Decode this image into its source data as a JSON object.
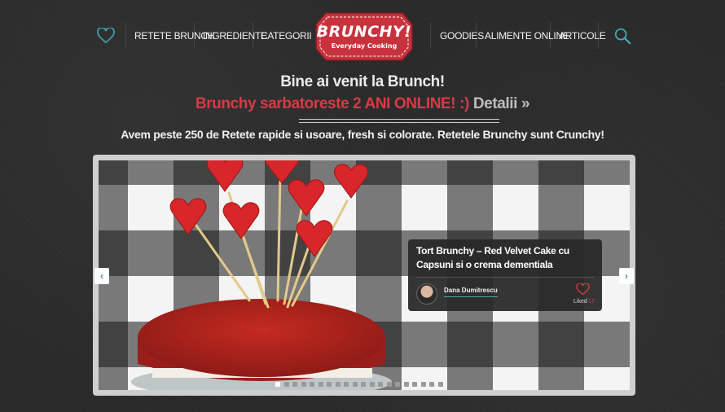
{
  "nav": {
    "left": [
      "RETETE BRUNCH",
      "INGREDIENTE",
      "CATEGORII"
    ],
    "right": [
      "GOODIES",
      "ALIMENTE ONLINE",
      "ARTICOLE"
    ]
  },
  "logo": {
    "title": "BRUNCHY!",
    "subtitle": "Everyday Cooking"
  },
  "hero": {
    "welcome": "Bine ai venit la Brunch!",
    "promo": "Brunchy sarbatoreste 2 ANI ONLINE! :)",
    "details": "Detalii »",
    "tagline": "Avem peste 250 de Retete rapide si usoare, fresh si colorate. Retetele Brunchy sunt Crunchy!"
  },
  "slider": {
    "recipe_title": "Tort Brunchy – Red Velvet Cake cu Capsuni si o crema dementiala",
    "author": "Dana Dumitrescu",
    "liked_label": "Liked",
    "liked_count": "17",
    "prev_arrow": "‹",
    "next_arrow": "›",
    "slide_count": 20,
    "active_slide": 1
  },
  "colors": {
    "accent_red": "#d83a44",
    "accent_teal": "#3fa9b4",
    "background": "#2a2a2a"
  },
  "icons": [
    "heart-icon",
    "search-icon",
    "chevron-left-icon",
    "chevron-right-icon"
  ]
}
